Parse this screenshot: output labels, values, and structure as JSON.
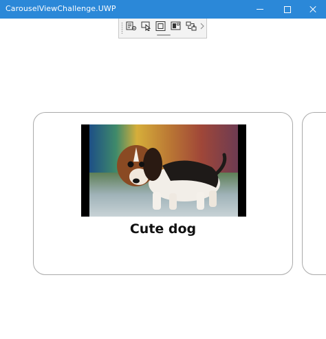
{
  "window": {
    "title": "CarouselViewChallenge.UWP",
    "accent": "#2b88d8"
  },
  "caption_buttons": [
    "minimize-icon",
    "maximize-icon",
    "close-icon"
  ],
  "debug_toolbar": {
    "tools": [
      "live-visual-tree-icon",
      "select-element-icon",
      "display-layout-adorners-icon",
      "track-focus-icon",
      "hot-reload-icon"
    ],
    "more": "chevron-right-icon"
  },
  "carousel": {
    "items": [
      {
        "title": "Cute dog",
        "image": "beagle-puppy-photo"
      }
    ]
  }
}
